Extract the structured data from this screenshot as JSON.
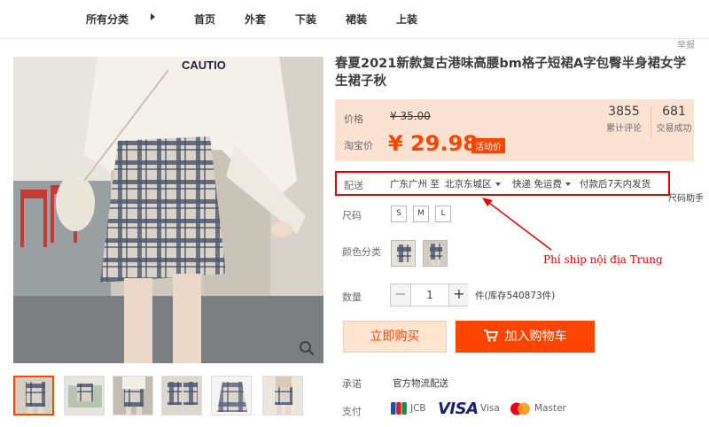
{
  "nav": {
    "categories": "所有分类",
    "items": [
      {
        "label": "首页"
      },
      {
        "label": "外套"
      },
      {
        "label": "下装"
      },
      {
        "label": "裙装"
      },
      {
        "label": "上装"
      }
    ],
    "report": "举报"
  },
  "product": {
    "title": "春夏2021新款复古港味高腰bm格子短裙A字包臀半身裙女学生裙子秋",
    "print_on_shirt": "CAUTIO"
  },
  "price": {
    "label": "价格",
    "original": "¥ 35.00",
    "taobao_label": "淘宝价",
    "current": "¥ 29.98",
    "promo_tag": "活动价"
  },
  "stats": {
    "reviews_count": "3855",
    "reviews_label": "累计评论",
    "deals_count": "681",
    "deals_label": "交易成功"
  },
  "shipping": {
    "label": "配送",
    "from": "广东广州 至",
    "to": "北京东城区",
    "method": "快递 免运费",
    "dispatch": "付款后7天内发货",
    "helper": "尺码助手"
  },
  "size": {
    "label": "尺码",
    "options": [
      "S",
      "M",
      "L"
    ]
  },
  "color": {
    "label": "颜色分类",
    "swatches": [
      "beige-plaid",
      "gray-plaid"
    ]
  },
  "annotation": {
    "text": "Phí ship nội địa Trung",
    "color": "#e00000"
  },
  "quantity": {
    "label": "数量",
    "value": "1",
    "minus": "−",
    "plus": "+",
    "stock": "件(库存540873件)"
  },
  "buttons": {
    "buy_now": "立即购买",
    "add_cart": "加入购物车"
  },
  "promise": {
    "label": "承诺",
    "value": "官方物流配送"
  },
  "payment": {
    "label": "支付",
    "methods": [
      {
        "name": "JCB"
      },
      {
        "name": "VISA"
      },
      {
        "name": "Visa"
      },
      {
        "name": "Master"
      }
    ]
  },
  "colors": {
    "accent": "#ff4400",
    "price_bg": "#fbe2d3",
    "highlight_border": "#e00000"
  }
}
